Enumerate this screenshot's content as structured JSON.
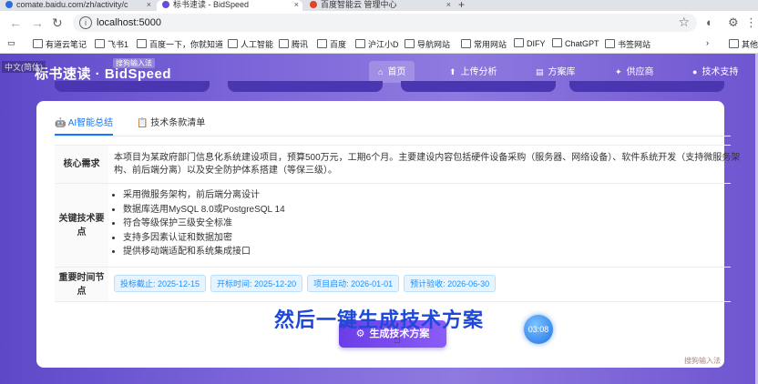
{
  "browser": {
    "tabs": [
      {
        "label": "comate.baidu.com/zh/activity/c",
        "color": "#2b6de0"
      },
      {
        "label": "标书速读 - BidSpeed",
        "color": "#6a4bd6"
      },
      {
        "label": "百度智能云 管理中心",
        "color": "#e0442b"
      }
    ],
    "tab_close": "×",
    "new_tab": "+",
    "url": "localhost:5000",
    "bookmarks": [
      "有道云笔记",
      "飞书1",
      "百度一下，你就知道",
      "人工智能",
      "腾讯",
      "百度",
      "沪江小D",
      "导航网站",
      "常用网站",
      "DIFY",
      "ChatGPT",
      "书签网站",
      "其他"
    ]
  },
  "app": {
    "brand": "标书速读 · BidSpeed",
    "overlay_text": "中文(简体)",
    "overlay_text2": "搜狗输入法",
    "nav": [
      {
        "label": "首页",
        "icon": "⌂",
        "active": true
      },
      {
        "label": "上传分析",
        "icon": "⬆",
        "active": false
      },
      {
        "label": "方案库",
        "icon": "▤",
        "active": false
      },
      {
        "label": "供应商",
        "icon": "✦",
        "active": false
      },
      {
        "label": "技术支持",
        "icon": "●",
        "active": false
      }
    ]
  },
  "card": {
    "tabs": [
      {
        "label": "AI智能总结",
        "icon": "🤖",
        "active": true
      },
      {
        "label": "技术条款清单",
        "icon": "📋",
        "active": false
      }
    ],
    "rows": {
      "core": {
        "label": "核心需求",
        "text": "本项目为某政府部门信息化系统建设项目，预算500万元，工期6个月。主要建设内容包括硬件设备采购（服务器、网络设备）、软件系统开发（支持微服务架构、前后端分离）以及安全防护体系搭建（等保三级）。"
      },
      "tech": {
        "label": "关键技术要点",
        "items": [
          "采用微服务架构，前后端分离设计",
          "数据库选用MySQL 8.0或PostgreSQL 14",
          "符合等级保护三级安全标准",
          "支持多因素认证和数据加密",
          "提供移动端适配和系统集成接口"
        ]
      },
      "dates": {
        "label": "重要时间节点",
        "tags": [
          "投标截止: 2025-12-15",
          "开标时间: 2025-12-20",
          "项目启动: 2026-01-01",
          "预计验收: 2026-06-30"
        ]
      }
    },
    "generate_button": "生成技术方案",
    "generate_icon": "⚙"
  },
  "overlay": {
    "timer": "03:08",
    "subtitle": "然后一键生成技术方案",
    "watermark": "搜狗输入法"
  },
  "colors": {
    "primary": "#1677ff",
    "brand_purple": "#6a3de8",
    "subtitle_blue": "#1e49d8"
  }
}
